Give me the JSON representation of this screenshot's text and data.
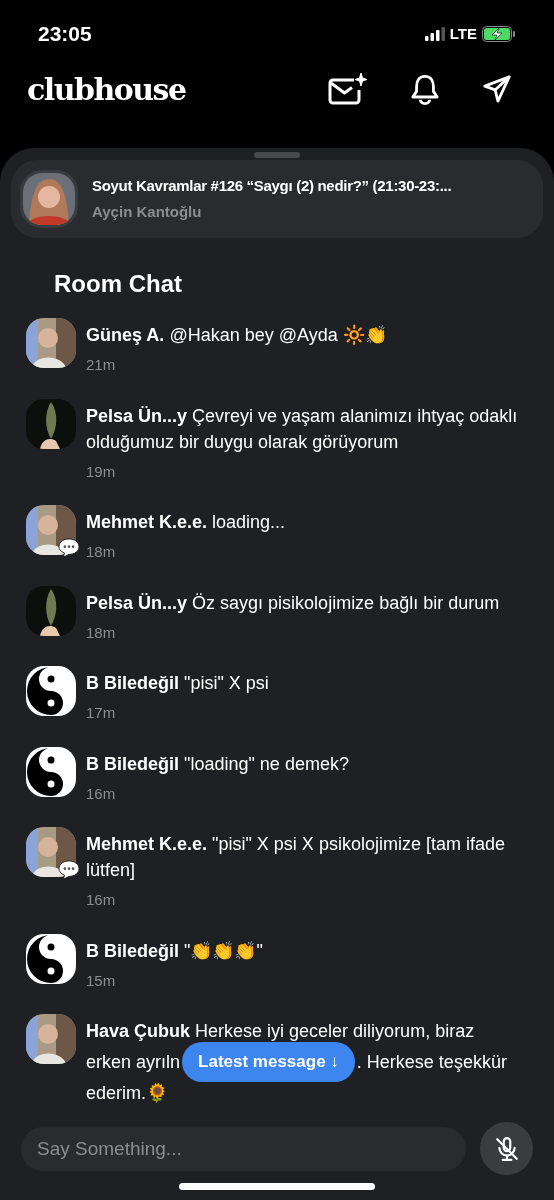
{
  "status_bar": {
    "time": "23:05",
    "network": "LTE"
  },
  "header": {
    "logo": "clubhouse"
  },
  "room": {
    "title": "Soyut Kavramlar #126 “Saygı (2) nedir?” (21:30-23:...",
    "host": "Ayçin Kantoğlu"
  },
  "chat": {
    "title": "Room Chat",
    "messages": [
      {
        "name": "Güneş A.",
        "text": "@Hakan bey @Ayda 🔆👏",
        "time": "21m",
        "chat_badge": false
      },
      {
        "name": "Pelsa Ün...y",
        "text": "Çevreyi ve yaşam alanimızı ihtyaç odaklı olduğumuz bir duygu olarak görüyorum",
        "time": "19m",
        "chat_badge": false
      },
      {
        "name": "Mehmet K.e.e.",
        "text": "loading...",
        "time": "18m",
        "chat_badge": true
      },
      {
        "name": "Pelsa Ün...y",
        "text": "Öz saygı pisikolojimize bağlı bir durum",
        "time": "18m",
        "chat_badge": false
      },
      {
        "name": "B Biledeğil",
        "text": "\"pisi\" X psi",
        "time": "17m",
        "chat_badge": false
      },
      {
        "name": "B Biledeğil",
        "text": "\"loading\" ne demek?",
        "time": "16m",
        "chat_badge": false
      },
      {
        "name": "Mehmet K.e.e.",
        "text": "\"pisi\" X psi X psikolojimize [tam ifade lütfen]",
        "time": "16m",
        "chat_badge": true
      },
      {
        "name": "B Biledeğil",
        "text": "\"👏👏👏\"",
        "time": "15m",
        "chat_badge": false
      }
    ],
    "last_message": {
      "name": "Hava Çubuk",
      "lines": [
        "Herkese iyi geceler diliyorum, biraz",
        "erken ayrıln",
        ". Herkese teşekkür",
        "ederim.🌻"
      ]
    },
    "latest_button": "Latest message ↓"
  },
  "composer": {
    "placeholder": "Say Something...",
    "mic_muted": true
  }
}
